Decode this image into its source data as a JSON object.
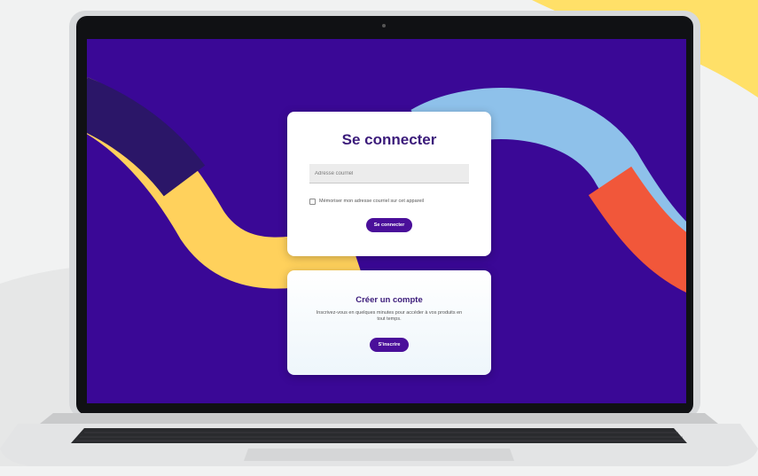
{
  "login": {
    "title": "Se connecter",
    "email_placeholder": "Adresse courriel",
    "remember_label": "Mémoriser mon adresse courriel sur cet appareil",
    "remember_checked": false,
    "submit_label": "Se connecter"
  },
  "signup": {
    "title": "Créer un compte",
    "description": "Inscrivez-vous en quelques minutes pour accéder à vos produits en tout temps.",
    "button_label": "S'inscrire"
  },
  "colors": {
    "screen_background": "#3a0896",
    "primary_button": "#4a0f9a",
    "title_text": "#3b1b7a",
    "wave_yellow": "#ffd15c",
    "wave_blue": "#8ec1ea",
    "wave_red": "#f1573a",
    "wave_dark": "#2b1668",
    "corner_yellow": "#ffe068"
  }
}
